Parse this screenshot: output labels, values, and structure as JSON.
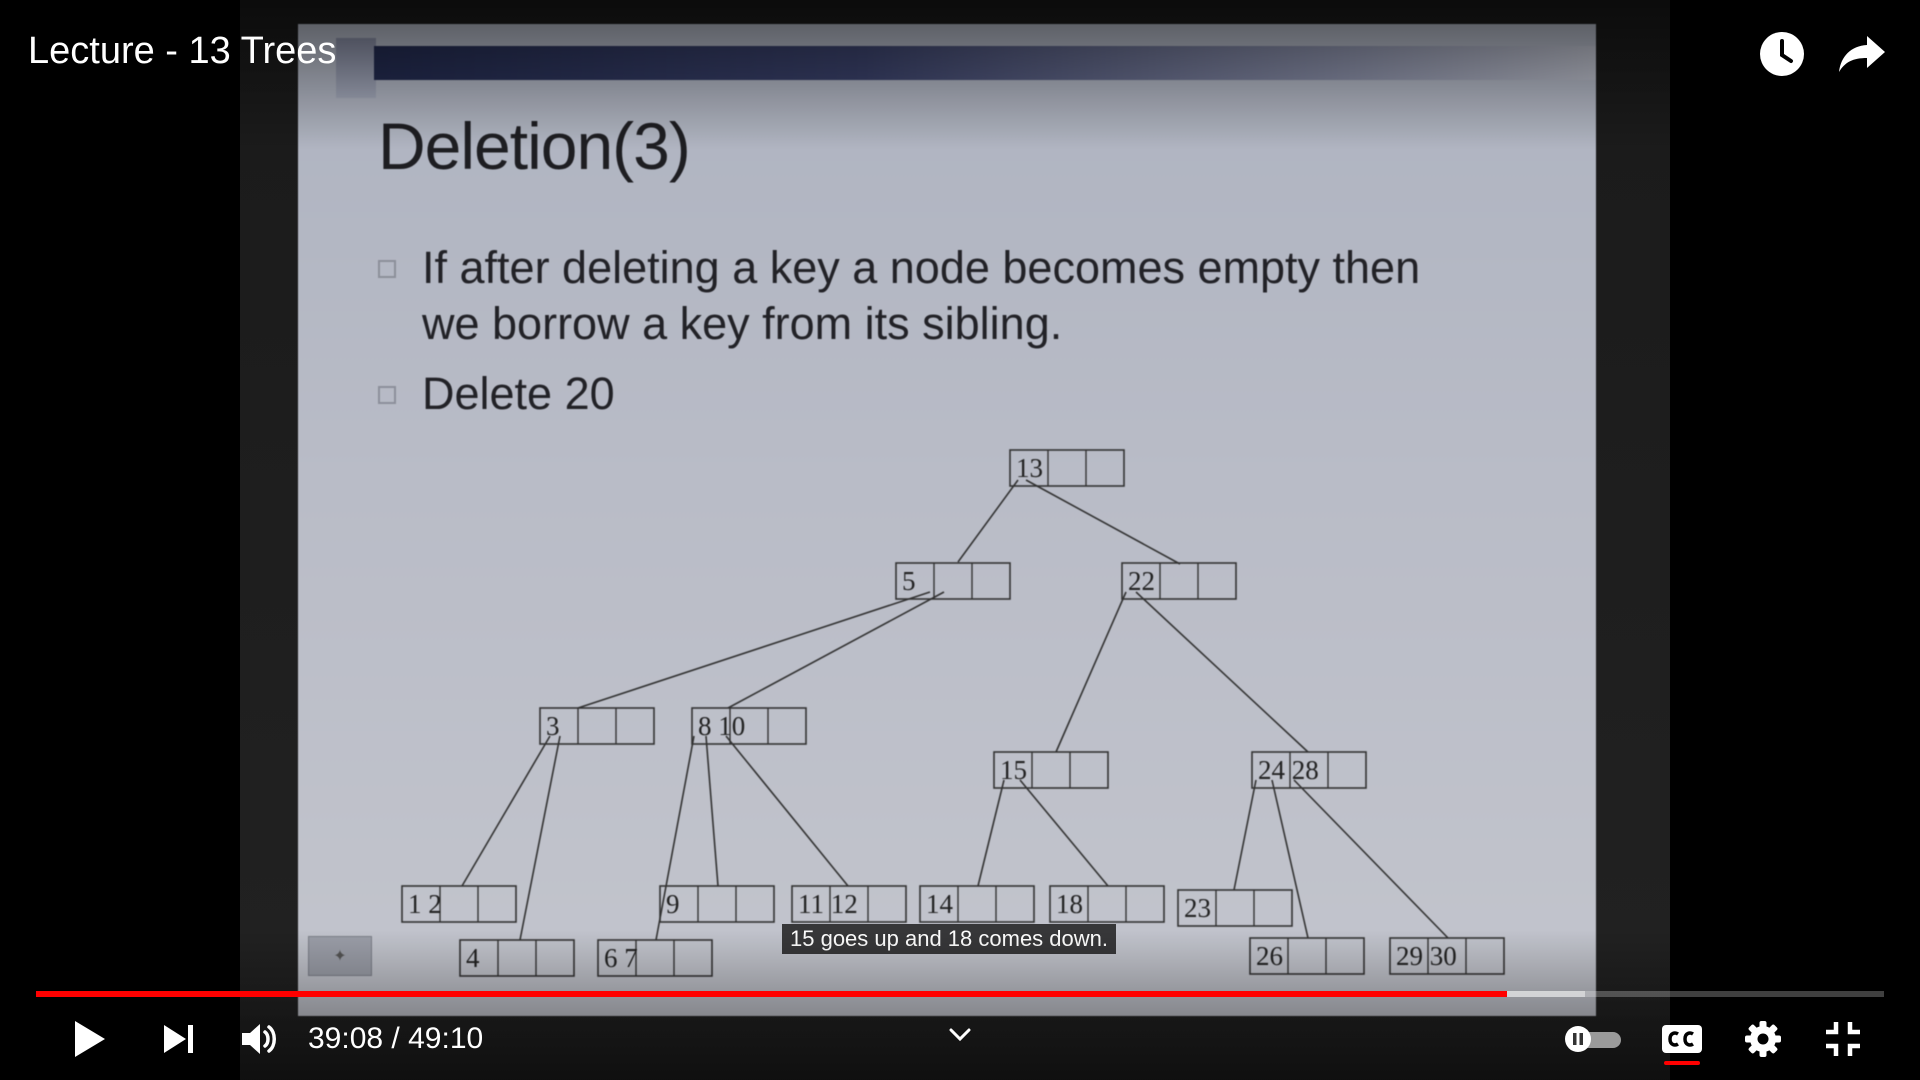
{
  "video": {
    "title": "Lecture - 13 Trees"
  },
  "slide": {
    "title": "Deletion(3)",
    "bullets": [
      "If after deleting a key a node becomes empty then we borrow a key from its sibling.",
      "Delete 20"
    ],
    "tree_nodes": [
      {
        "id": "root",
        "keys": "13"
      },
      {
        "id": "n5",
        "keys": "5"
      },
      {
        "id": "n22",
        "keys": "22"
      },
      {
        "id": "n3",
        "keys": "3"
      },
      {
        "id": "n8_10",
        "keys": "8 10"
      },
      {
        "id": "n15",
        "keys": "15"
      },
      {
        "id": "n24_28",
        "keys": "24 28"
      },
      {
        "id": "l1_2",
        "keys": "1 2"
      },
      {
        "id": "l4",
        "keys": "4"
      },
      {
        "id": "l6_7",
        "keys": "6 7"
      },
      {
        "id": "l9",
        "keys": "9"
      },
      {
        "id": "l11_12",
        "keys": "11 12"
      },
      {
        "id": "l14",
        "keys": "14"
      },
      {
        "id": "l18",
        "keys": "18"
      },
      {
        "id": "l23",
        "keys": "23"
      },
      {
        "id": "l26",
        "keys": "26"
      },
      {
        "id": "l29_30",
        "keys": "29 30"
      }
    ]
  },
  "caption": {
    "text": "15 goes up and 18 comes down."
  },
  "player": {
    "current_time": "39:08",
    "separator": "/",
    "duration": "49:10",
    "progress_fraction": 0.796,
    "buffered_fraction": 0.838,
    "colors": {
      "played": "#ff0000",
      "control_icon": "#ffffff"
    },
    "icons": {
      "watch_later": "clock-icon",
      "share": "share-arrow-icon",
      "play": "play-icon",
      "next": "next-icon",
      "volume": "volume-icon",
      "chapters": "chevron-down-icon",
      "autoplay": "autoplay-toggle",
      "captions": "cc-icon",
      "settings": "gear-icon",
      "exit_fullscreen": "exit-fullscreen-icon"
    }
  }
}
